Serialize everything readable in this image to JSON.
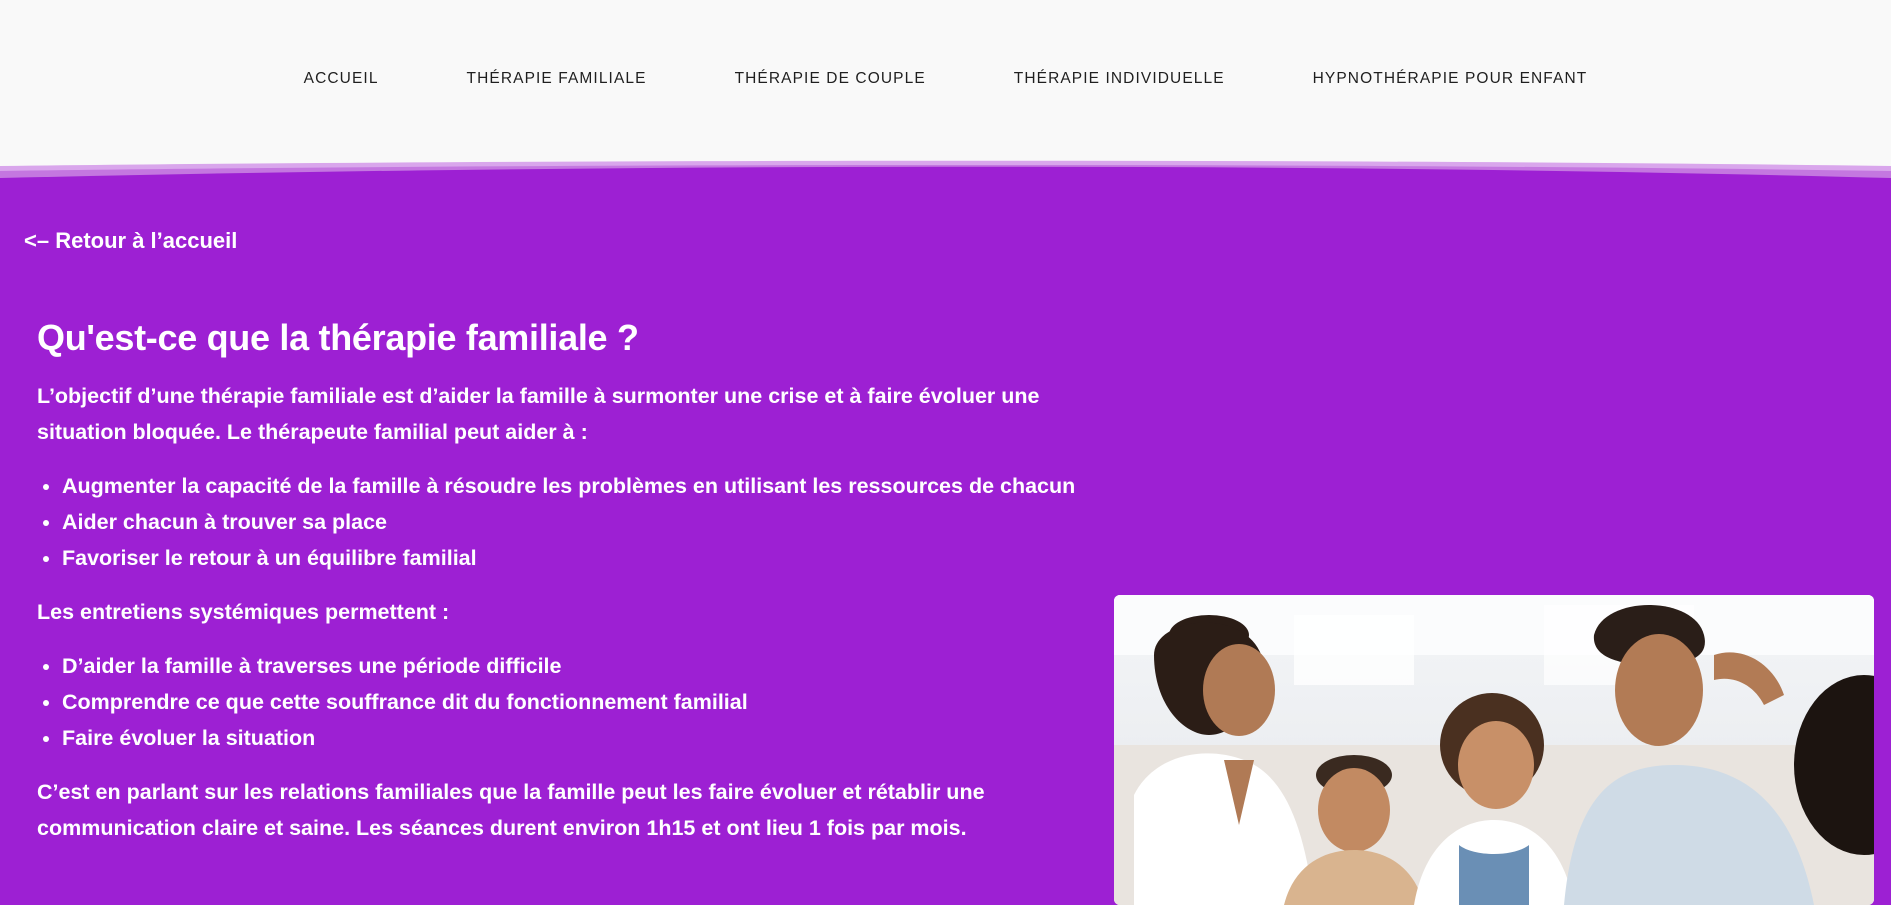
{
  "nav": {
    "items": [
      {
        "label": "ACCUEIL"
      },
      {
        "label": "THÉRAPIE FAMILIALE"
      },
      {
        "label": "THÉRAPIE DE COUPLE"
      },
      {
        "label": "THÉRAPIE INDIVIDUELLE"
      },
      {
        "label": "HYPNOTHÉRAPIE POUR ENFANT"
      }
    ]
  },
  "back_link": "<– Retour à l’accueil",
  "main": {
    "title": "Qu'est-ce que la thérapie familiale ?",
    "intro": "L’objectif d’une thérapie familiale est d’aider la famille à surmonter une crise et à faire évoluer une situation bloquée. Le thérapeute familial peut aider à :",
    "list1": [
      "Augmenter la capacité de la famille à résoudre les problèmes en utilisant les ressources de chacun",
      "Aider chacun à trouver sa place",
      "Favoriser le retour à un équilibre familial"
    ],
    "para2": "Les entretiens systémiques permettent :",
    "list2": [
      "D’aider la famille à traverses une période difficile",
      "Comprendre ce que cette souffrance dit du fonctionnement familial",
      "Faire évoluer la situation"
    ],
    "para3": "C’est en parlant sur les relations familiales que la famille peut les faire évoluer et rétablir une communication claire et saine. Les séances durent environ 1h15 et ont lieu 1 fois par mois."
  },
  "colors": {
    "accent": "#9d20d3",
    "header_bg": "#f9f9f9",
    "nav_text": "#1f1f1f",
    "text": "#ffffff"
  },
  "image": {
    "name": "family-photo"
  }
}
